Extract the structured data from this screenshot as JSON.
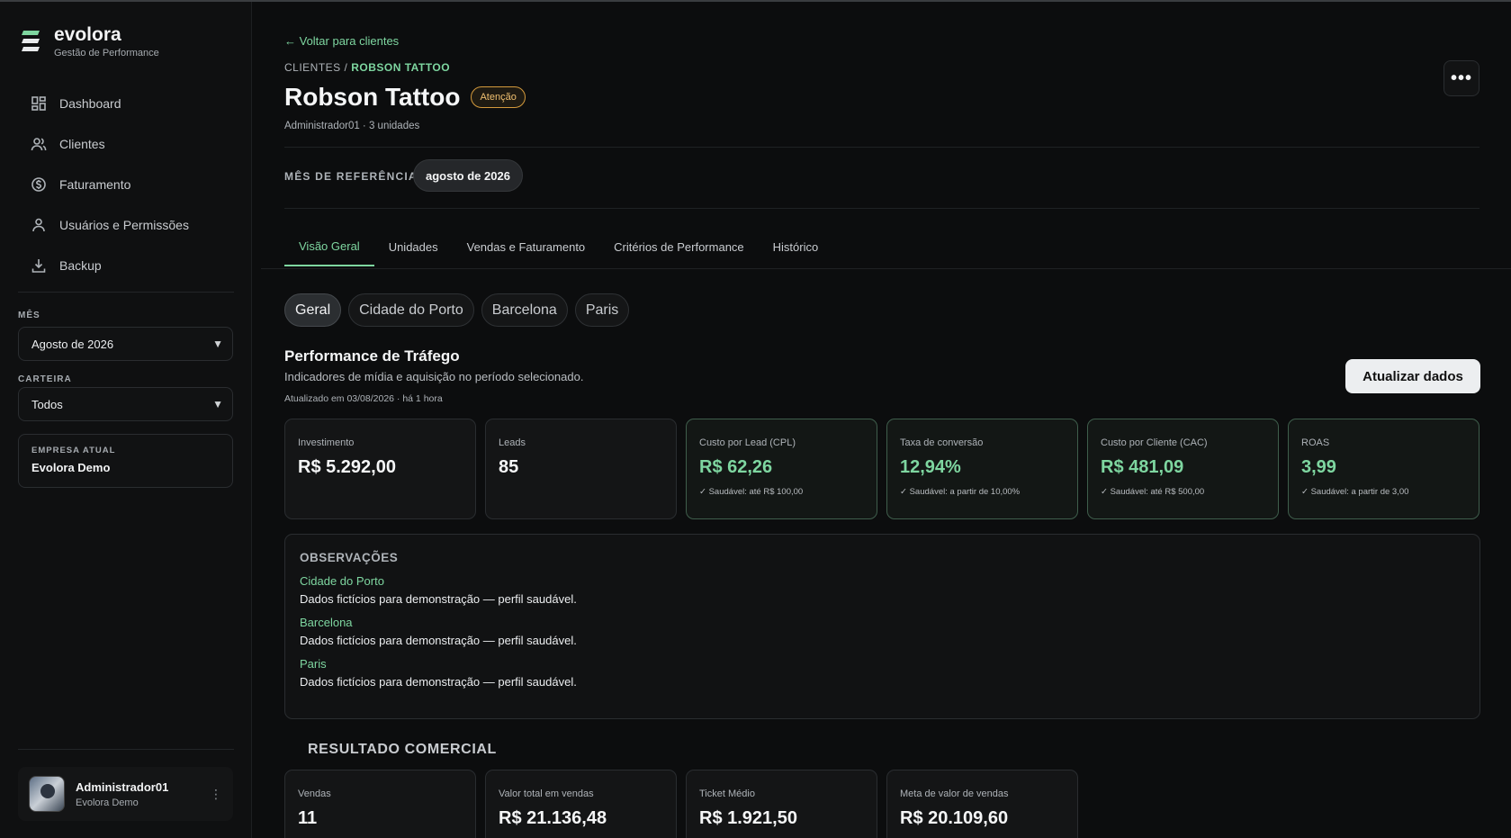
{
  "brand": {
    "name": "evolora",
    "subtitle": "Gestão de Performance"
  },
  "nav": [
    {
      "label": "Dashboard",
      "icon": "dashboard-icon"
    },
    {
      "label": "Clientes",
      "icon": "users-icon"
    },
    {
      "label": "Faturamento",
      "icon": "dollar-icon"
    },
    {
      "label": "Usuários e Permissões",
      "icon": "user-icon"
    },
    {
      "label": "Backup",
      "icon": "download-icon"
    }
  ],
  "filters": {
    "month_label": "MÊS",
    "month_value": "Agosto de 2026",
    "portfolio_label": "CARTEIRA",
    "portfolio_value": "Todos"
  },
  "company": {
    "label": "EMPRESA ATUAL",
    "name": "Evolora Demo"
  },
  "user": {
    "name": "Administrador01",
    "company": "Evolora Demo"
  },
  "header": {
    "back_link": "← Voltar para clientes",
    "breadcrumb_root": "CLIENTES",
    "breadcrumb_sep": " / ",
    "breadcrumb_current": "ROBSON TATTOO",
    "title": "Robson Tattoo",
    "status": "Atenção",
    "owner": "Administrador01",
    "meta_sep": " · ",
    "units_count": "3 unidades",
    "more": "•••"
  },
  "reference": {
    "label": "MÊS DE REFERÊNCIA",
    "value": "agosto de 2026"
  },
  "tabs": [
    "Visão Geral",
    "Unidades",
    "Vendas e Faturamento",
    "Critérios de Performance",
    "Histórico"
  ],
  "units": [
    "Geral",
    "Cidade do Porto",
    "Barcelona",
    "Paris"
  ],
  "traffic": {
    "title": "Performance de Tráfego",
    "description": "Indicadores de mídia e aquisição no período selecionado.",
    "updated": "Atualizado em 03/08/2026 · há 1 hora",
    "refresh_label": "Atualizar dados",
    "metrics": [
      {
        "label": "Investimento",
        "value": "R$ 5.292,00",
        "note": ""
      },
      {
        "label": "Leads",
        "value": "85",
        "note": ""
      },
      {
        "label": "Custo por Lead (CPL)",
        "value": "R$ 62,26",
        "note": "✓ Saudável: até R$ 100,00"
      },
      {
        "label": "Taxa de conversão",
        "value": "12,94%",
        "note": "✓ Saudável: a partir de 10,00%"
      },
      {
        "label": "Custo por Cliente (CAC)",
        "value": "R$ 481,09",
        "note": "✓ Saudável: até R$ 500,00"
      },
      {
        "label": "ROAS",
        "value": "3,99",
        "note": "✓ Saudável: a partir de 3,00"
      }
    ]
  },
  "observations": {
    "title": "OBSERVAÇÕES",
    "items": [
      {
        "unit": "Cidade do Porto",
        "text": "Dados fictícios para demonstração — perfil saudável."
      },
      {
        "unit": "Barcelona",
        "text": "Dados fictícios para demonstração — perfil saudável."
      },
      {
        "unit": "Paris",
        "text": "Dados fictícios para demonstração — perfil saudável."
      }
    ]
  },
  "commercial": {
    "title": "RESULTADO COMERCIAL",
    "metrics": [
      {
        "label": "Vendas",
        "value": "11"
      },
      {
        "label": "Valor total em vendas",
        "value": "R$ 21.136,48"
      },
      {
        "label": "Ticket Médio",
        "value": "R$ 1.921,50"
      },
      {
        "label": "Meta de valor de vendas",
        "value": "R$ 20.109,60"
      }
    ]
  },
  "colors": {
    "accent": "#7ed6a0",
    "warning": "#d49a3c",
    "background": "#0c0d0e"
  }
}
